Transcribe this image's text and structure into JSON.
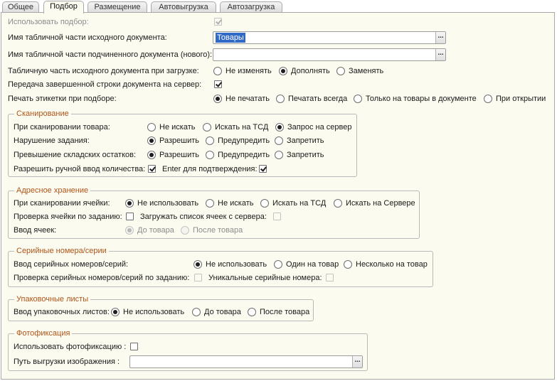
{
  "tabs": [
    "Общее",
    "Подбор",
    "Размещение",
    "Автовыгрузка",
    "Автозагрузка"
  ],
  "main": {
    "use_selection_label": "Использовать подбор:",
    "source_table_label": "Имя табличной части исходного документа:",
    "source_table_value": "Товары",
    "sub_table_label": "Имя табличной части подчиненного документа (нового):",
    "sub_table_value": "",
    "load_mode_label": "Табличную часть исходного документа при загрузке:",
    "load_mode_options": [
      "Не изменять",
      "Дополнять",
      "Заменять"
    ],
    "load_mode_selected": "Дополнять",
    "transfer_label": "Передача завершенной строки документа на сервер:",
    "print_label": "Печать этикетки при подборе:",
    "print_options": [
      "Не печатать",
      "Печатать всегда",
      "Только на товары в документе",
      "При открытии"
    ],
    "print_selected": "Не печатать"
  },
  "scan": {
    "title": "Сканирование",
    "scan_item_label": "При сканировании товара:",
    "scan_item_options": [
      "Не искать",
      "Искать на ТСД",
      "Запрос на сервер"
    ],
    "task_violation_label": "Нарушение задания:",
    "task_violation_options": [
      "Разрешить",
      "Предупредить",
      "Запретить"
    ],
    "stock_excess_label": "Превышение складских остатков:",
    "stock_excess_options": [
      "Разрешить",
      "Предупредить",
      "Запретить"
    ],
    "manual_qty_label": "Разрешить ручной ввод количества:",
    "enter_confirm_label": "Enter для подтверждения:"
  },
  "address": {
    "title": "Адресное хранение",
    "scan_cell_label": "При сканировании ячейки:",
    "scan_cell_options": [
      "Не использовать",
      "Не искать",
      "Искать на ТСД",
      "Искать на Сервере"
    ],
    "check_cell_label": "Проверка ячейки по заданию:",
    "load_cells_label": "Загружать список ячеек с сервера:",
    "cell_input_label": "Ввод ячеек:",
    "cell_input_options": [
      "До товара",
      "После товара"
    ]
  },
  "serial": {
    "title": "Серийные номера/серии",
    "input_label": "Ввод серийных номеров/серий:",
    "input_options": [
      "Не использовать",
      "Один на товар",
      "Несколько на товар"
    ],
    "check_label": "Проверка серийных номеров/серий по заданию:",
    "unique_label": "Уникальные серийные номера:"
  },
  "packing": {
    "title": "Упаковочные листы",
    "input_label": "Ввод упаковочных листов:",
    "input_options": [
      "Не использовать",
      "До товара",
      "После товара"
    ]
  },
  "photo": {
    "title": "Фотофиксация",
    "use_label": "Использовать фотофиксацию :",
    "path_label": "Путь выгрузки изображения :",
    "path_value": ""
  },
  "dots_label": "..."
}
